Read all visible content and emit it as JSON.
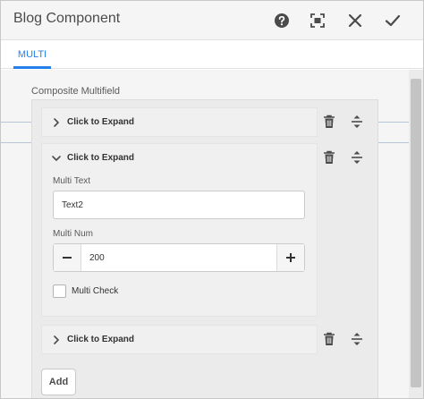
{
  "dialog": {
    "title": "Blog Component",
    "header_icons": [
      "help-icon",
      "fullscreen-icon",
      "close-icon",
      "done-icon"
    ]
  },
  "tabs": [
    {
      "label": "MULTI",
      "active": true
    }
  ],
  "multifield": {
    "label": "Composite Multifield",
    "add_label": "Add",
    "items": [
      {
        "title": "Click to Expand",
        "expanded": false
      },
      {
        "title": "Click to Expand",
        "expanded": true,
        "text_label": "Multi Text",
        "text_value": "Text2",
        "num_label": "Multi Num",
        "num_value": "200",
        "check_label": "Multi Check",
        "checked": false
      },
      {
        "title": "Click to Expand",
        "expanded": false
      }
    ]
  },
  "colors": {
    "accent": "#2680eb",
    "header_bg": "#f5f5f5",
    "content_bg": "#f5f5f5"
  }
}
